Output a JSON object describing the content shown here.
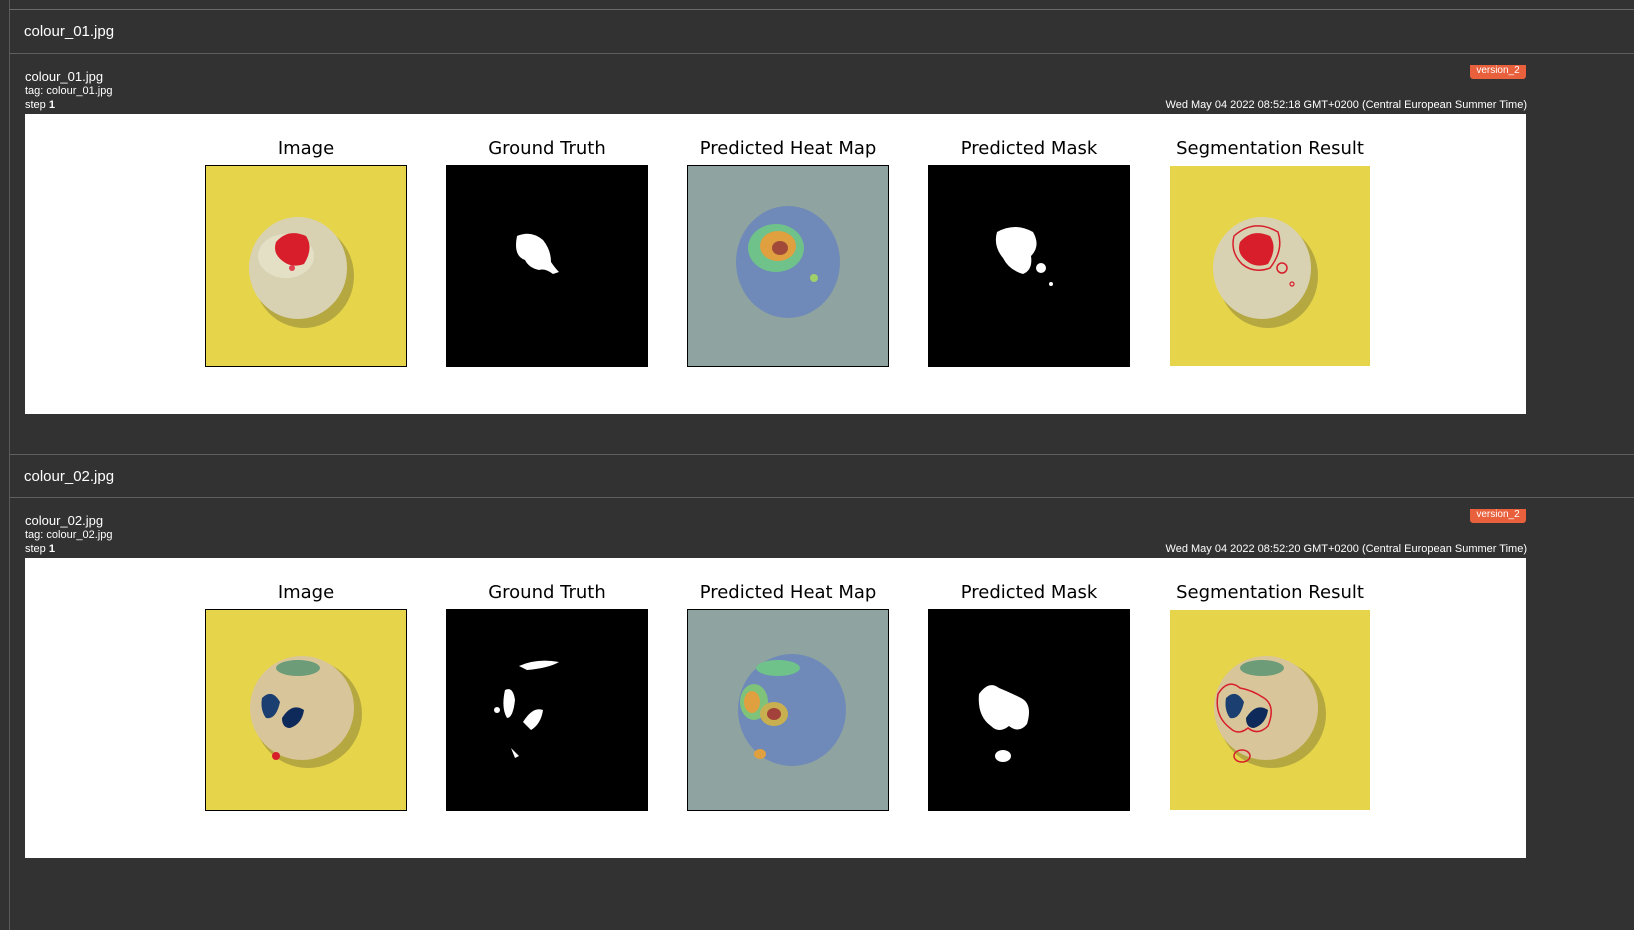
{
  "sections": [
    {
      "header": "colour_01.jpg",
      "card": {
        "name": "colour_01.jpg",
        "tag": "tag: colour_01.jpg",
        "step_label": "step",
        "step_value": "1",
        "badge": "version_2",
        "timestamp": "Wed May 04 2022 08:52:18 GMT+0200 (Central European Summer Time)"
      },
      "panels": [
        "Image",
        "Ground Truth",
        "Predicted Heat Map",
        "Predicted Mask",
        "Segmentation Result"
      ]
    },
    {
      "header": "colour_02.jpg",
      "card": {
        "name": "colour_02.jpg",
        "tag": "tag: colour_02.jpg",
        "step_label": "step",
        "step_value": "1",
        "badge": "version_2",
        "timestamp": "Wed May 04 2022 08:52:20 GMT+0200 (Central European Summer Time)"
      },
      "panels": [
        "Image",
        "Ground Truth",
        "Predicted Heat Map",
        "Predicted Mask",
        "Segmentation Result"
      ]
    }
  ],
  "colors": {
    "background": "#323232",
    "badge": "#e8603c",
    "image_bg": "#e6d54a",
    "defect": "#d81e2a",
    "mask": "#000000"
  }
}
